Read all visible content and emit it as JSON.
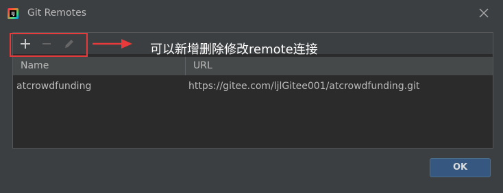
{
  "window": {
    "title": "Git Remotes"
  },
  "app_icon": {
    "label": "IJ"
  },
  "background": {
    "ghost_text": "",
    "ghost_link": ""
  },
  "toolbar": {
    "add_icon": "plus-icon",
    "remove_icon": "minus-icon",
    "edit_icon": "pencil-icon"
  },
  "annotation": {
    "text": "可以新增删除修改remote连接",
    "color": "#e83a3a"
  },
  "table": {
    "columns": [
      "Name",
      "URL"
    ],
    "rows": [
      {
        "name": "atcrowdfunding",
        "url": "https://gitee.com/ljlGitee001/atcrowdfunding.git"
      }
    ]
  },
  "footer": {
    "ok_label": "OK"
  },
  "colors": {
    "accent": "#365880",
    "background": "#3c3f41",
    "panel": "#2b2b2b"
  }
}
